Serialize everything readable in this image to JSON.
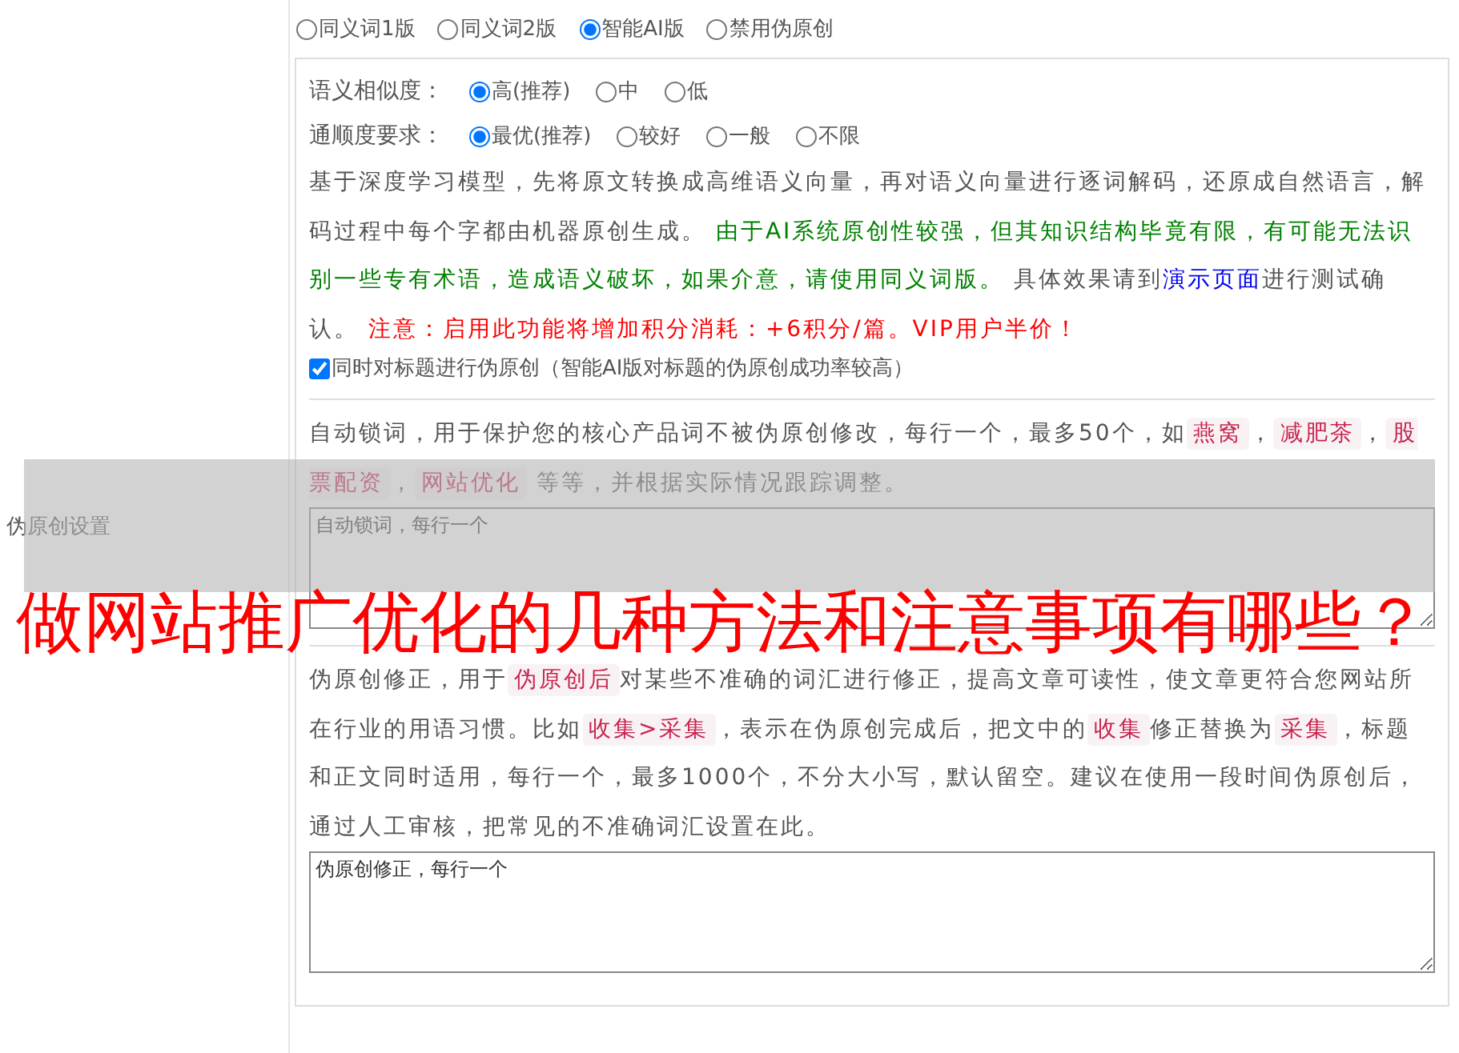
{
  "sidebar_label": "伪原创设置",
  "modes": [
    {
      "label": "同义词1版",
      "selected": false
    },
    {
      "label": "同义词2版",
      "selected": false
    },
    {
      "label": "智能AI版",
      "selected": true
    },
    {
      "label": "禁用伪原创",
      "selected": false
    }
  ],
  "similarity": {
    "label": "语义相似度：",
    "options": [
      {
        "label": "高(推荐)",
        "selected": true
      },
      {
        "label": "中",
        "selected": false
      },
      {
        "label": "低",
        "selected": false
      }
    ]
  },
  "fluency": {
    "label": "通顺度要求：",
    "options": [
      {
        "label": "最优(推荐)",
        "selected": true
      },
      {
        "label": "较好",
        "selected": false
      },
      {
        "label": "一般",
        "selected": false
      },
      {
        "label": "不限",
        "selected": false
      }
    ]
  },
  "ai_description": [
    {
      "kind": "text",
      "text": "基于深度学习模型，先将原文转换成高维语义向量，再对语义向量进行逐词解码，还原成自然语言，解码过程中每个字都由机器原创生成。 "
    },
    {
      "kind": "note",
      "text": "由于AI系统原创性较强，但其知识结构毕竟有限，有可能无法识别一些专有术语，造成语义破坏，如果介意，请使用同义词版。"
    },
    {
      "kind": "text",
      "text": " 具体效果请到"
    },
    {
      "kind": "link",
      "text": "演示页面"
    },
    {
      "kind": "text",
      "text": "进行测试确认。 "
    },
    {
      "kind": "warning",
      "text": "注意：启用此功能将增加积分消耗：+6积分/篇。VIP用户半价！"
    }
  ],
  "title_option": {
    "label": "同时对标题进行伪原创（智能AI版对标题的伪原创成功率较高）",
    "checked": true
  },
  "lock_words": {
    "description": [
      {
        "kind": "text",
        "text": "自动锁词，用于保护您的核心产品词不被伪原创修改，每行一个，最多50个，如"
      },
      {
        "kind": "tag",
        "text": "燕窝"
      },
      {
        "kind": "text",
        "text": "，"
      },
      {
        "kind": "tag",
        "text": "减肥茶"
      },
      {
        "kind": "text",
        "text": "，"
      },
      {
        "kind": "tag",
        "text": "股票配资"
      },
      {
        "kind": "text",
        "text": "，"
      },
      {
        "kind": "tag",
        "text": "网站优化"
      },
      {
        "kind": "text",
        "text": " 等等，并根据实际情况跟踪调整。"
      }
    ],
    "placeholder": "自动锁词，每行一个"
  },
  "corrections": {
    "description": [
      {
        "kind": "text",
        "text": "伪原创修正，用于"
      },
      {
        "kind": "tag",
        "text": "伪原创后"
      },
      {
        "kind": "text",
        "text": "对某些不准确的词汇进行修正，提高文章可读性，使文章更符合您网站所在行业的用语习惯。比如"
      },
      {
        "kind": "tag",
        "text": "收集>采集"
      },
      {
        "kind": "text",
        "text": "，表示在伪原创完成后，把文中的"
      },
      {
        "kind": "tag",
        "text": "收集"
      },
      {
        "kind": "text",
        "text": "修正替换为"
      },
      {
        "kind": "tag",
        "text": "采集"
      },
      {
        "kind": "text",
        "text": "，标题和正文同时适用，每行一个，最多1000个，不分大小写，默认留空。建议在使用一段时间伪原创后，通过人工审核，把常见的不准确词汇设置在此。"
      }
    ],
    "placeholder": "伪原创修正，每行一个"
  },
  "banner": {
    "title": "做网站推广优化的几种方法和注意事项有哪些？"
  }
}
